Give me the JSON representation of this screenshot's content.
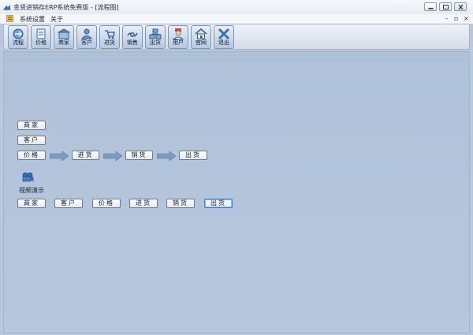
{
  "window": {
    "title": "金贤进销存ERP系统免费版 - [流程图]"
  },
  "menu": {
    "items": [
      "系统设置",
      "关于"
    ],
    "mdi_controls": [
      "-",
      "▫",
      "×"
    ]
  },
  "toolbar": {
    "buttons": [
      {
        "label": "流程",
        "icon": "flow-icon"
      },
      {
        "label": "价格",
        "icon": "price-tag-icon"
      },
      {
        "label": "商家",
        "icon": "store-icon"
      },
      {
        "label": "客户",
        "icon": "customer-icon"
      },
      {
        "label": "进货",
        "icon": "purchase-icon"
      },
      {
        "label": "销售",
        "icon": "sales-icon"
      },
      {
        "label": "出货",
        "icon": "shipment-icon"
      },
      {
        "label": "用户",
        "icon": "user-icon"
      },
      {
        "label": "官网",
        "icon": "home-icon"
      },
      {
        "label": "退出",
        "icon": "exit-icon"
      }
    ]
  },
  "flow": {
    "left_column": [
      "商家",
      "客户",
      "价格"
    ],
    "chain": [
      "进货",
      "销货",
      "出货"
    ]
  },
  "video": {
    "label": "视频演示",
    "buttons": [
      "商家",
      "客户",
      "价格",
      "进货",
      "销货",
      "出货"
    ],
    "active_index": 5
  },
  "colors": {
    "workspace": "#b3c4db",
    "toolbar_button": "#b5c8de",
    "active_border": "#3e7ec9"
  }
}
